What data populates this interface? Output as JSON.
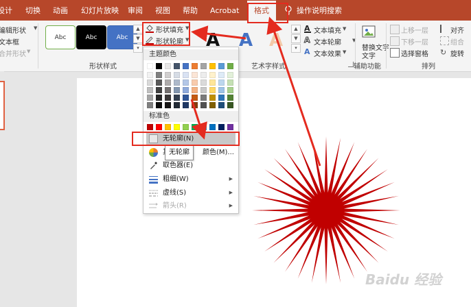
{
  "tabs": [
    {
      "label": "设计"
    },
    {
      "label": "切换"
    },
    {
      "label": "动画"
    },
    {
      "label": "幻灯片放映"
    },
    {
      "label": "审阅"
    },
    {
      "label": "视图"
    },
    {
      "label": "帮助"
    },
    {
      "label": "Acrobat"
    },
    {
      "label": "格式"
    }
  ],
  "tellme": "操作说明搜索",
  "ribbon": {
    "insert_shapes": {
      "edit_shape": "编辑形状",
      "textbox": "文本框",
      "merge_shapes": "合并形状"
    },
    "shape_styles": {
      "group_label": "形状样式",
      "presets": [
        {
          "label": "Abc"
        },
        {
          "label": "Abc"
        },
        {
          "label": "Abc"
        }
      ],
      "fill": "形状填充",
      "outline": "形状轮廓"
    },
    "wordart": {
      "group_label": "艺术字样式",
      "letters": [
        "A",
        "A",
        "A"
      ],
      "text_fill": "文本填充",
      "text_outline": "文本轮廓",
      "text_effects": "文本效果"
    },
    "accessibility": {
      "alt_text": "替换文字",
      "alt_text_line2": "文字",
      "group_label": "辅助功能"
    },
    "arrange": {
      "group_label": "排列",
      "bring_forward": "上移一层",
      "send_backward": "下移一层",
      "selection_pane": "选择窗格",
      "align": "对齐",
      "group": "组合",
      "rotate": "旋转"
    }
  },
  "dropdown": {
    "theme_colors_header": "主题颜色",
    "standard_colors_header": "标准色",
    "theme_top": [
      "#ffffff",
      "#000000",
      "#e7e6e6",
      "#44546a",
      "#4472c4",
      "#ed7d31",
      "#a5a5a5",
      "#ffc000",
      "#5b9bd5",
      "#70ad47"
    ],
    "theme_shades": [
      [
        "#f2f2f2",
        "#808080",
        "#d0cece",
        "#d6dce5",
        "#d9e2f3",
        "#fbe5d6",
        "#ededed",
        "#fff2cc",
        "#deebf7",
        "#e2f0d9"
      ],
      [
        "#d9d9d9",
        "#595959",
        "#aeabab",
        "#adb9ca",
        "#b4c7e7",
        "#f8cbad",
        "#dbdbdb",
        "#ffe699",
        "#bdd7ee",
        "#c5e0b4"
      ],
      [
        "#bfbfbf",
        "#404040",
        "#757171",
        "#8497b0",
        "#8faadc",
        "#f4b183",
        "#c9c9c9",
        "#ffd966",
        "#9dc3e6",
        "#a9d18e"
      ],
      [
        "#a6a6a6",
        "#262626",
        "#3b3838",
        "#333f50",
        "#2f5597",
        "#c55a11",
        "#7b7b7b",
        "#bf9000",
        "#2e75b6",
        "#548235"
      ],
      [
        "#7f7f7f",
        "#0d0d0d",
        "#171616",
        "#222a35",
        "#1f3864",
        "#843c0c",
        "#525252",
        "#7f6000",
        "#1f4e79",
        "#385723"
      ]
    ],
    "standard": [
      "#c00000",
      "#ff0000",
      "#ffc000",
      "#ffff00",
      "#92d050",
      "#00b050",
      "#00b0f0",
      "#0070c0",
      "#002060",
      "#7030a0"
    ],
    "items": {
      "no_outline": "无轮廓(N)",
      "more_colors_prefix": "其",
      "more_colors_suffix": "颜色(M)...",
      "eyedropper": "取色器(E)",
      "weight": "粗细(W)",
      "dashes": "虚线(S)",
      "arrows": "箭头(R)"
    },
    "tooltip": "无轮廓"
  },
  "canvas": {
    "shape_color": "#c00000"
  },
  "watermark": "Baidu 经验",
  "colors": {
    "accent": "#b7472a",
    "annotation": "#e42b1f"
  }
}
